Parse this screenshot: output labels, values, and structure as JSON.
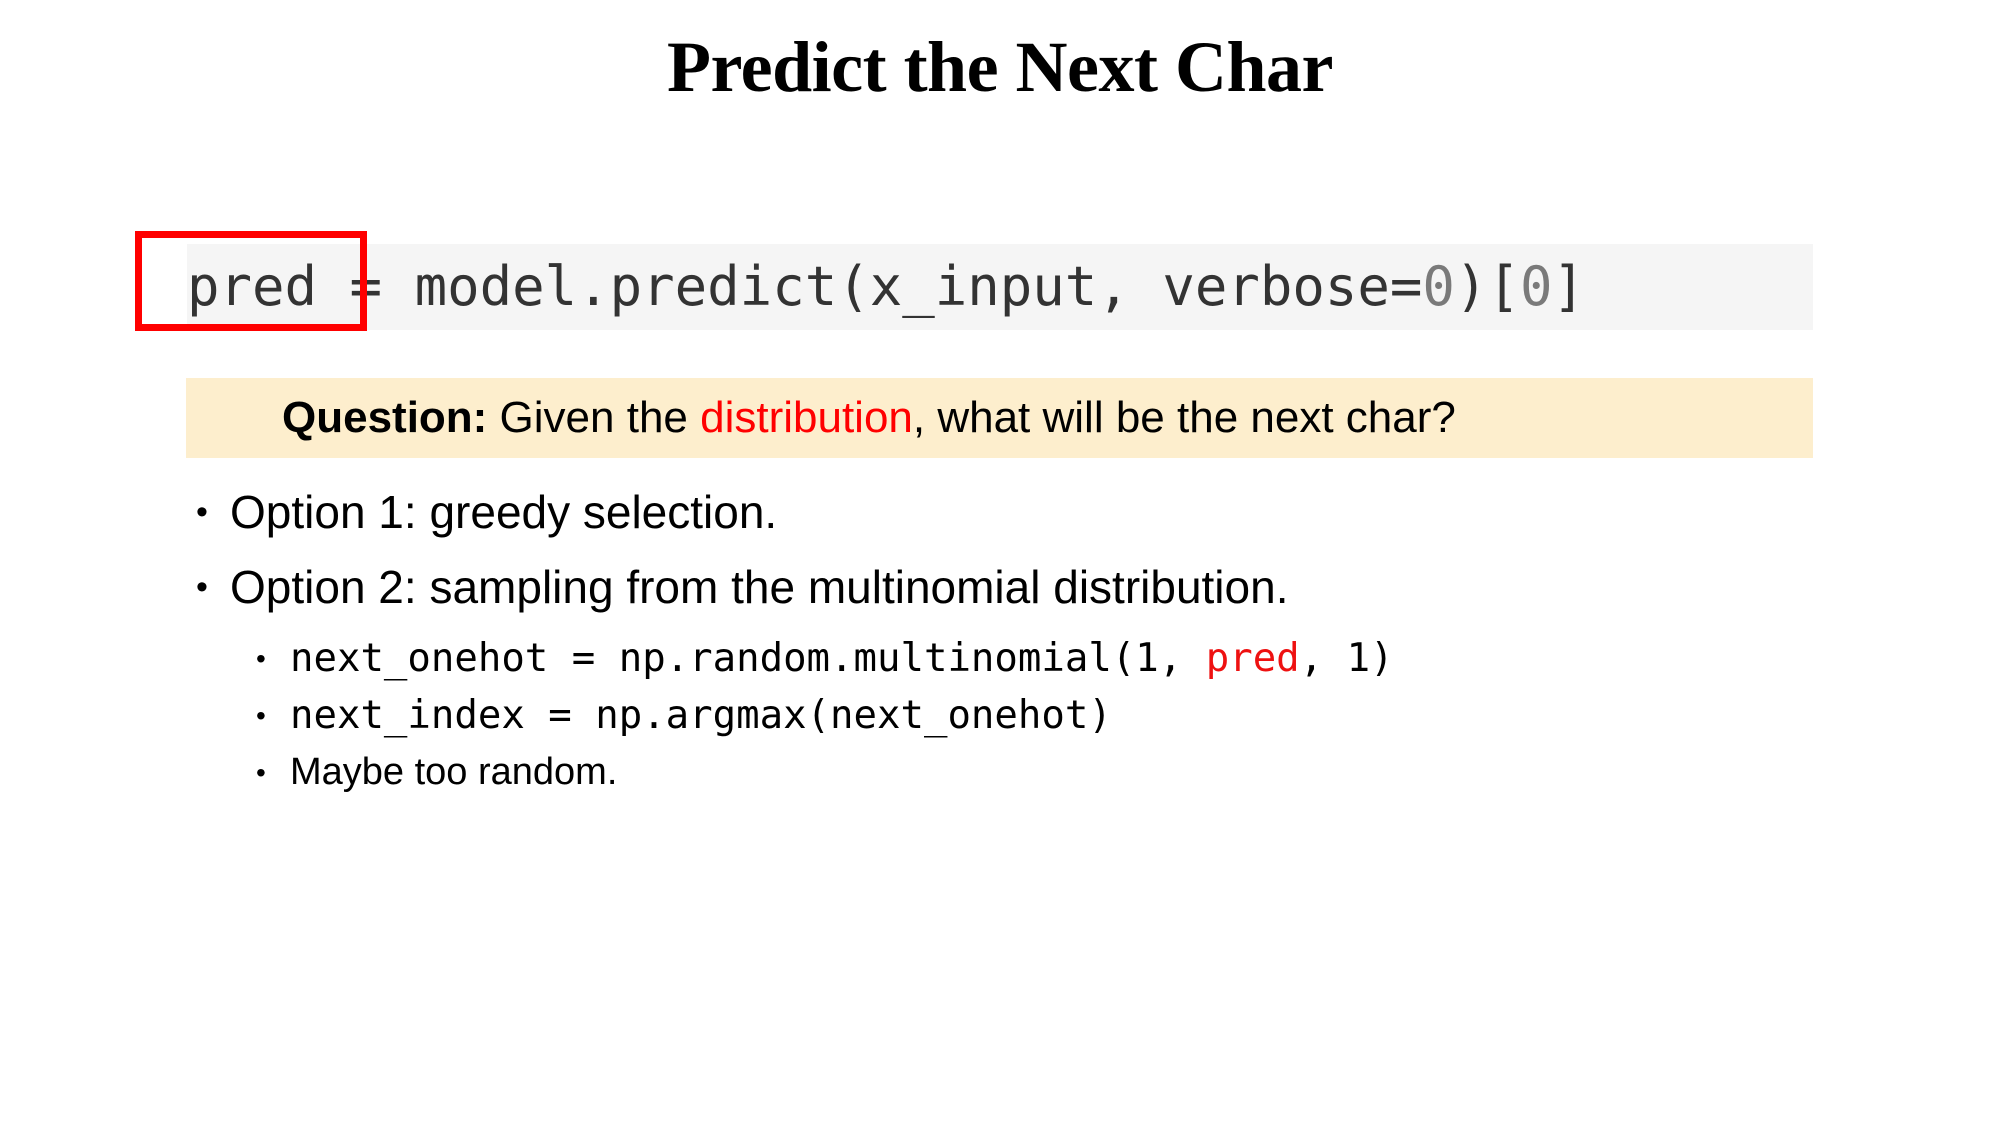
{
  "slide": {
    "title": "Predict the Next Char",
    "background_color": "#ffffff"
  },
  "code_block": {
    "background_color": "#f5f5f5",
    "text_color": "#333333",
    "number_color": "#7a7a7a",
    "segments": {
      "var": "pred",
      "assign": " = model.predict(x_input, verbose=",
      "num_zero": "0",
      "close_paren": ")[",
      "num_zero2": "0",
      "close_bracket": "]"
    },
    "full_text": "pred = model.predict(x_input, verbose=0)[0]",
    "callout": {
      "target": "pred",
      "border_color": "#ff0000",
      "border_width_px": 7
    }
  },
  "question_banner": {
    "background_color": "#fdeecd",
    "label": "Question:",
    "text_before": " Given the ",
    "highlight": "distribution",
    "highlight_color": "#ff0000",
    "text_after": ", what will be the next char?",
    "full_text": "Question: Given the distribution, what will be the next char?"
  },
  "bullets": [
    {
      "bullet_glyph": "•",
      "text": "Option 1: greedy selection.",
      "sub_items": []
    },
    {
      "bullet_glyph": "•",
      "text": "Option 2: sampling from the multinomial distribution.",
      "sub_items": [
        {
          "bullet_glyph": "•",
          "style": "mono",
          "parts": [
            {
              "text": "next_onehot = np.random.multinomial(1, ",
              "color": "#000000"
            },
            {
              "text": "pred",
              "color": "#ee1111"
            },
            {
              "text": ", 1)",
              "color": "#000000"
            }
          ],
          "full_text": "next_onehot = np.random.multinomial(1, pred, 1)"
        },
        {
          "bullet_glyph": "•",
          "style": "mono",
          "parts": [
            {
              "text": "next_index = np.argmax(next_onehot)",
              "color": "#000000"
            }
          ],
          "full_text": "next_index = np.argmax(next_onehot)"
        },
        {
          "bullet_glyph": "•",
          "style": "sans",
          "parts": [
            {
              "text": "Maybe too random.",
              "color": "#000000"
            }
          ],
          "full_text": "Maybe too random."
        }
      ]
    }
  ]
}
